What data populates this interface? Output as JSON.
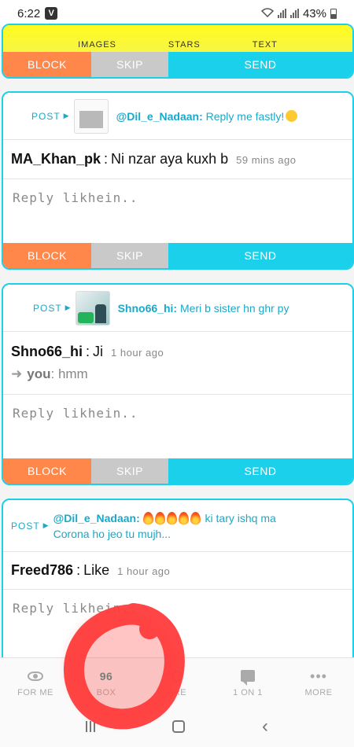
{
  "status": {
    "time": "6:22",
    "app_icon": "V",
    "battery": "43%"
  },
  "top_card": {
    "tabs": [
      "IMAGES",
      "STARS",
      "TEXT"
    ],
    "block_label": "BLOCK",
    "skip_label": "SKIP",
    "send_label": "SEND"
  },
  "cards": [
    {
      "post_label": "POST",
      "post_user": "@Dil_e_Nadaan:",
      "post_text": "Reply me fastly!",
      "comment_user": "MA_Khan_pk",
      "comment_text": "Ni nzar aya kuxh b",
      "comment_time": "59 mins ago",
      "reply_placeholder": "Reply likhein..",
      "block_label": "BLOCK",
      "skip_label": "SKIP",
      "send_label": "SEND"
    },
    {
      "post_label": "POST",
      "post_user": "Shno66_hi:",
      "post_text": "Meri b sister hn ghr py",
      "comment_user": "Shno66_hi",
      "comment_text": "Ji",
      "comment_time": "1 hour ago",
      "reply_you": "you",
      "reply_text": "hmm",
      "reply_placeholder": "Reply likhein..",
      "block_label": "BLOCK",
      "skip_label": "SKIP",
      "send_label": "SEND"
    },
    {
      "post_label": "POST",
      "post_user": "@Dil_e_Nadaan:",
      "post_text": "ki tary ishq ma",
      "post_text_2": "Corona ho jeo tu mujh...",
      "comment_user": "Freed786",
      "comment_text": "Like",
      "comment_time": "1 hour ago",
      "reply_placeholder": "Reply likhein.."
    }
  ],
  "nav": [
    {
      "label": "FOR ME",
      "icon": "eye-icon"
    },
    {
      "label": "BOX",
      "count": "96"
    },
    {
      "label": "ARE",
      "icon": "share-icon"
    },
    {
      "label": "1 ON 1",
      "icon": "chat-icon"
    },
    {
      "label": "MORE",
      "icon": "dots-icon"
    }
  ],
  "colors": {
    "accent": "#1bd0ea",
    "block": "#ff8749",
    "skip": "#c9c9c9",
    "annotation": "#ff3b3b"
  }
}
